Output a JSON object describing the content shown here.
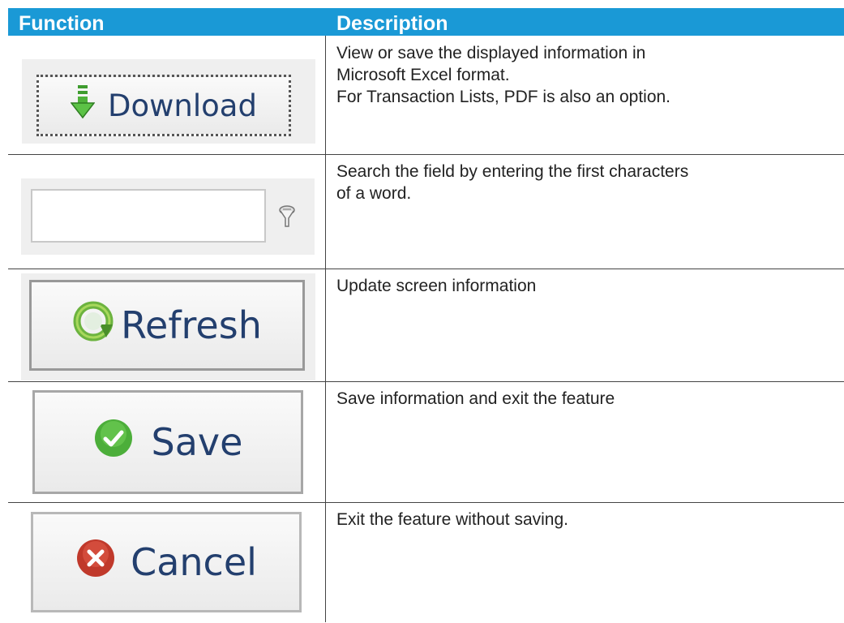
{
  "header": {
    "function_label": "Function",
    "description_label": "Description",
    "background_color": "#1a99d6"
  },
  "rows": [
    {
      "button_label": "Download",
      "icon": "download-arrow-icon",
      "description_lines": [
        "View or save the displayed information in",
        "Microsoft Excel format.",
        "For Transaction Lists, PDF is also an option."
      ]
    },
    {
      "button_label": "",
      "icon": "filter-funnel-icon",
      "description_lines": [
        "Search the field by entering the first characters",
        "of a word."
      ]
    },
    {
      "button_label": "Refresh",
      "icon": "refresh-icon",
      "description_lines": [
        "Update screen information"
      ]
    },
    {
      "button_label": "Save",
      "icon": "check-circle-icon",
      "description_lines": [
        "Save information and exit the feature"
      ]
    },
    {
      "button_label": "Cancel",
      "icon": "cancel-circle-icon",
      "description_lines": [
        "Exit the feature without saving."
      ]
    }
  ]
}
